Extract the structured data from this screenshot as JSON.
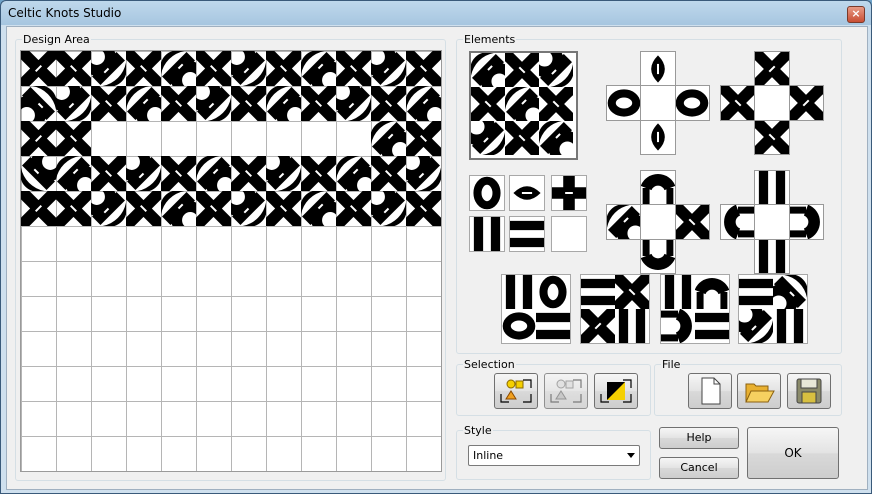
{
  "window": {
    "title": "Celtic Knots Studio",
    "close_label": "×"
  },
  "design_area": {
    "label": "Design Area"
  },
  "elements": {
    "label": "Elements"
  },
  "selection": {
    "label": "Selection",
    "buttons": [
      "select-shapes",
      "deselect-shapes",
      "invert-colors"
    ]
  },
  "file": {
    "label": "File"
  },
  "style": {
    "label": "Style",
    "selected": "Inline"
  },
  "buttons": {
    "help": "Help",
    "cancel": "Cancel",
    "ok": "OK"
  },
  "colors": {
    "knot": "#000000",
    "grid": "#b5b5b5",
    "accent_yellow": "#f5d000"
  }
}
